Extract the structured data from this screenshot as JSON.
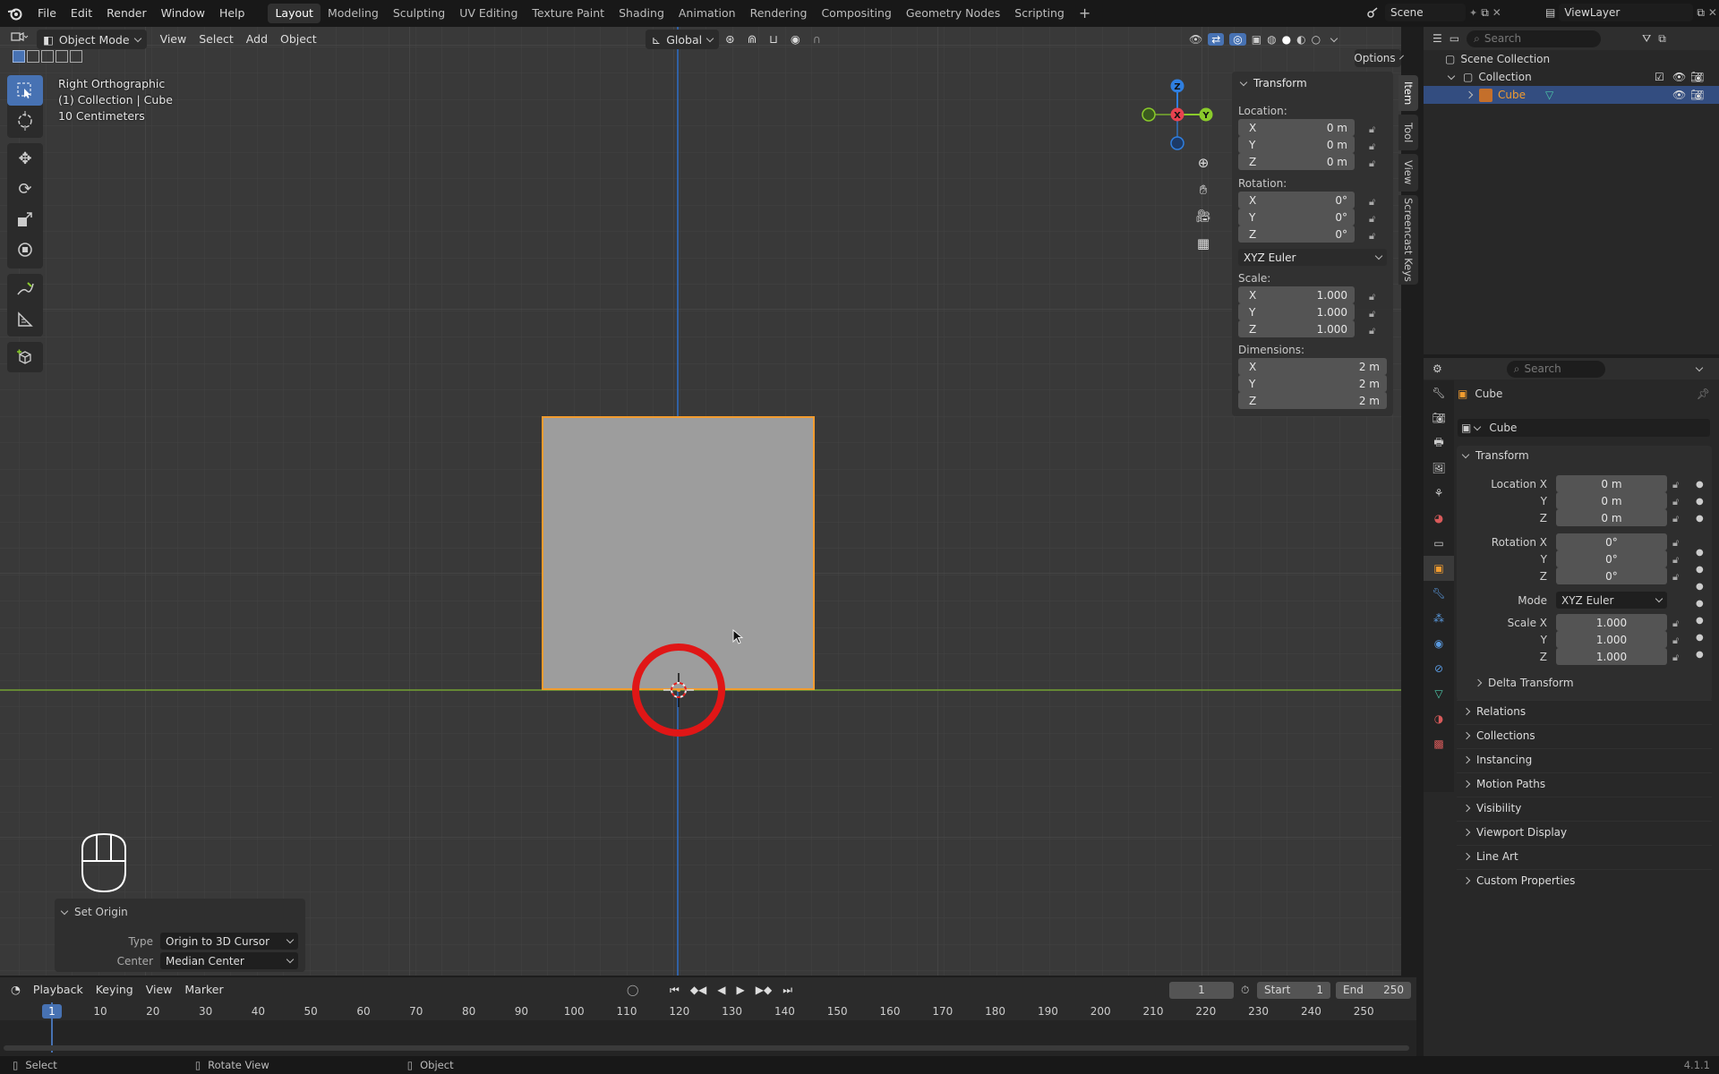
{
  "menu": [
    "File",
    "Edit",
    "Render",
    "Window",
    "Help"
  ],
  "workspaces": [
    "Layout",
    "Modeling",
    "Sculpting",
    "UV Editing",
    "Texture Paint",
    "Shading",
    "Animation",
    "Rendering",
    "Compositing",
    "Geometry Nodes",
    "Scripting"
  ],
  "active_workspace": "Layout",
  "scene_name": "Scene",
  "view_layer": "ViewLayer",
  "viewport_header": {
    "mode": "Object Mode",
    "menus": [
      "View",
      "Select",
      "Add",
      "Object"
    ],
    "orientation": "Global",
    "options": "Options"
  },
  "overlay_info": {
    "view_name": "Right Orthographic",
    "collection": "(1) Collection | Cube",
    "scale": "10 Centimeters"
  },
  "gizmo_axes": {
    "z": "Z",
    "x": "X",
    "y": "Y"
  },
  "npanel": {
    "title": "Transform",
    "location_label": "Location:",
    "rotation_label": "Rotation:",
    "scale_label": "Scale:",
    "dimensions_label": "Dimensions:",
    "location": [
      {
        "axis": "X",
        "value": "0 m"
      },
      {
        "axis": "Y",
        "value": "0 m"
      },
      {
        "axis": "Z",
        "value": "0 m"
      }
    ],
    "rotation": [
      {
        "axis": "X",
        "value": "0°"
      },
      {
        "axis": "Y",
        "value": "0°"
      },
      {
        "axis": "Z",
        "value": "0°"
      }
    ],
    "rotation_mode": "XYZ Euler",
    "scale": [
      {
        "axis": "X",
        "value": "1.000"
      },
      {
        "axis": "Y",
        "value": "1.000"
      },
      {
        "axis": "Z",
        "value": "1.000"
      }
    ],
    "dimensions": [
      {
        "axis": "X",
        "value": "2 m"
      },
      {
        "axis": "Y",
        "value": "2 m"
      },
      {
        "axis": "Z",
        "value": "2 m"
      }
    ],
    "tabs": [
      "Item",
      "Tool",
      "View",
      "Screencast Keys"
    ]
  },
  "operator_panel": {
    "title": "Set Origin",
    "type_label": "Type",
    "type_value": "Origin to 3D Cursor",
    "center_label": "Center",
    "center_value": "Median Center"
  },
  "outliner": {
    "search_placeholder": "Search",
    "scene_collection": "Scene Collection",
    "collection": "Collection",
    "object": "Cube"
  },
  "properties": {
    "search_placeholder": "Search",
    "object_name": "Cube",
    "datablock_name": "Cube",
    "transform_title": "Transform",
    "location_x_label": "Location X",
    "y_label": "Y",
    "z_label": "Z",
    "rotation_x_label": "Rotation X",
    "mode_label": "Mode",
    "mode_value": "XYZ Euler",
    "scale_x_label": "Scale X",
    "location": [
      "0 m",
      "0 m",
      "0 m"
    ],
    "rotation": [
      "0°",
      "0°",
      "0°"
    ],
    "scale": [
      "1.000",
      "1.000",
      "1.000"
    ],
    "delta_transform": "Delta Transform",
    "sections": [
      "Relations",
      "Collections",
      "Instancing",
      "Motion Paths",
      "Visibility",
      "Viewport Display",
      "Line Art",
      "Custom Properties"
    ]
  },
  "timeline": {
    "menus": [
      "Playback",
      "Keying",
      "View",
      "Marker"
    ],
    "current_frame": "1",
    "start_label": "Start",
    "start_value": "1",
    "end_label": "End",
    "end_value": "250",
    "playhead_label": "1",
    "ticks": [
      "10",
      "20",
      "30",
      "40",
      "50",
      "60",
      "70",
      "80",
      "90",
      "100",
      "110",
      "120",
      "130",
      "140",
      "150",
      "160",
      "170",
      "180",
      "190",
      "200",
      "210",
      "220",
      "230",
      "240",
      "250"
    ]
  },
  "statusbar": {
    "select": "Select",
    "rotate_view": "Rotate View",
    "object": "Object",
    "version": "4.1.1"
  },
  "colors": {
    "selection_outline": "#f29c2f",
    "axis_x": "#e8424f",
    "axis_y": "#8acb2b",
    "axis_z": "#2f7fe0",
    "highlight_circle": "#e01616",
    "active_blue": "#4772b3"
  }
}
